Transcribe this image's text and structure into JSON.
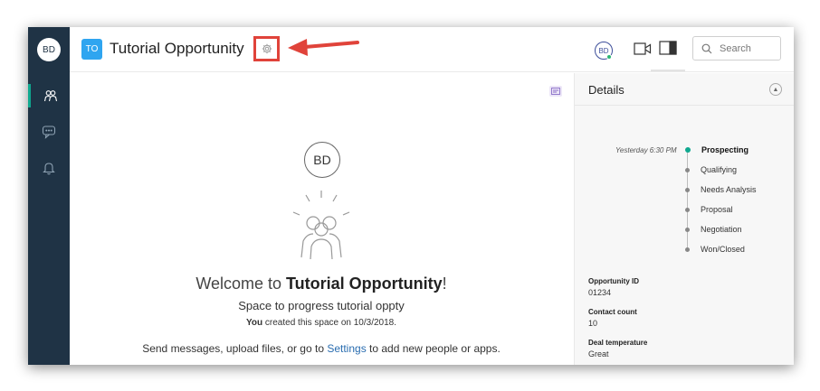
{
  "rail": {
    "avatar_initials": "BD",
    "items": [
      {
        "icon": "people-icon",
        "active": true
      },
      {
        "icon": "chat-icon",
        "active": false
      },
      {
        "icon": "bell-icon",
        "active": false
      }
    ]
  },
  "header": {
    "space_badge": "TO",
    "space_title": "Tutorial Opportunity",
    "settings_icon": "gear-icon",
    "user_initials": "BD",
    "search_placeholder": "Search"
  },
  "welcome": {
    "avatar_initials": "BD",
    "prefix": "Welcome to ",
    "space_name": "Tutorial Opportunity",
    "suffix": "!",
    "subtitle": "Space to progress tutorial oppty",
    "created_by": "You",
    "created_text": " created this space on 10/3/2018.",
    "hint_prefix": "Send messages, upload files, or go to ",
    "hint_link": "Settings",
    "hint_suffix": " to add new people or apps."
  },
  "details": {
    "title": "Details",
    "stage_timestamp": "Yesterday 6:30 PM",
    "stages": [
      "Prospecting",
      "Qualifying",
      "Needs Analysis",
      "Proposal",
      "Negotiation",
      "Won/Closed"
    ],
    "current_stage": "Prospecting",
    "fields": [
      {
        "label": "Opportunity ID",
        "value": "01234"
      },
      {
        "label": "Contact count",
        "value": "10"
      },
      {
        "label": "Deal temperature",
        "value": "Great"
      }
    ]
  },
  "colors": {
    "rail_bg": "#1f3345",
    "accent_teal": "#0fa88f",
    "badge_blue": "#2fa5f0",
    "highlight_red": "#e0433a",
    "link_blue": "#2a6db0"
  }
}
